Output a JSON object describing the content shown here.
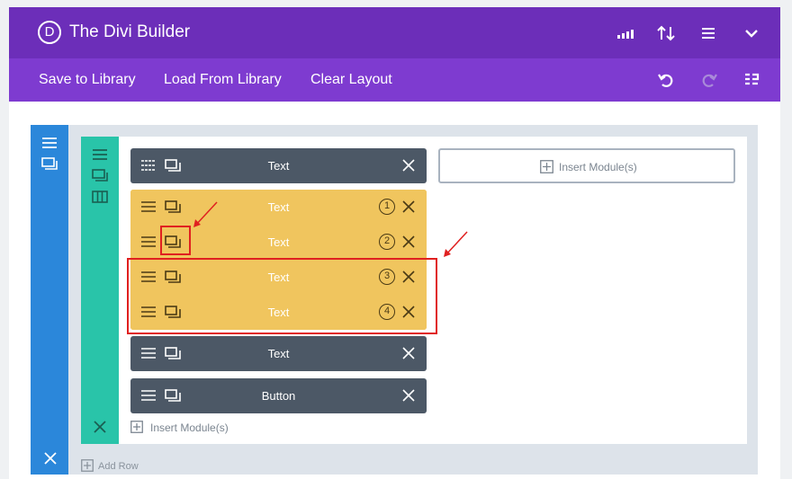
{
  "app": {
    "logo_letter": "D",
    "title": "The Divi Builder",
    "header_icons": [
      "portability-icon",
      "sort-icon",
      "menu-icon",
      "chevron-down-icon"
    ]
  },
  "toolbar": {
    "save_label": "Save to Library",
    "load_label": "Load From Library",
    "clear_label": "Clear Layout",
    "right_icons": [
      "undo-icon",
      "redo-icon",
      "history-icon"
    ]
  },
  "modules": [
    {
      "label": "Text",
      "color": "dark"
    },
    {
      "label": "Text",
      "color": "yellow",
      "number": "1"
    },
    {
      "label": "Text",
      "color": "yellow",
      "number": "2"
    },
    {
      "label": "Text",
      "color": "yellow",
      "number": "3"
    },
    {
      "label": "Text",
      "color": "yellow",
      "number": "4"
    },
    {
      "label": "Text",
      "color": "dark"
    },
    {
      "label": "Button",
      "color": "dark"
    }
  ],
  "insert_module_label": "Insert Module(s)",
  "add_row_label": "Add Row",
  "colors": {
    "header": "#6c2eb9",
    "toolbar": "#7e3bd0",
    "section": "#2b87da",
    "row": "#29c4a9",
    "module_dark": "#4c5866",
    "module_selected": "#f0c55e",
    "annotation": "#e02020"
  }
}
